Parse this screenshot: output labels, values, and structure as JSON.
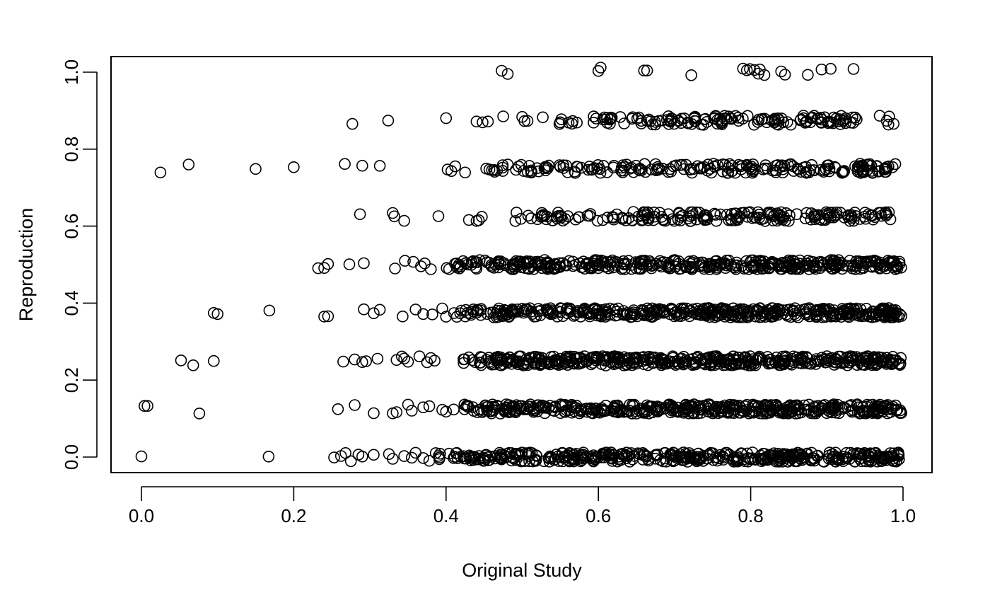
{
  "chart_data": {
    "type": "scatter",
    "title": "",
    "xlabel": "Original Study",
    "ylabel": "Reproduction",
    "xlim": [
      0.0,
      1.0
    ],
    "ylim": [
      0.0,
      1.0
    ],
    "xticks": [
      "0.0",
      "0.2",
      "0.4",
      "0.6",
      "0.8",
      "1.0"
    ],
    "yticks": [
      "0.0",
      "0.2",
      "0.4",
      "0.6",
      "0.8",
      "1.0"
    ],
    "grid": false,
    "legend": "none",
    "marker": "open-circle",
    "color": "#000000",
    "levels": [
      {
        "y": 1.0,
        "points": [
          0.473,
          0.481,
          0.6,
          0.603,
          0.66,
          0.664,
          0.722,
          0.79,
          0.795,
          0.799,
          0.805,
          0.81,
          0.812,
          0.818,
          0.84,
          0.845,
          0.875,
          0.893,
          0.905,
          0.935
        ],
        "dense": []
      },
      {
        "y": 0.875,
        "points": [
          0.277,
          0.324,
          0.4,
          0.44,
          0.448,
          0.455,
          0.475,
          0.5,
          0.503,
          0.507,
          0.527
        ],
        "dense": [
          {
            "from": 0.545,
            "to": 0.94,
            "count": 150
          },
          {
            "from": 0.962,
            "to": 0.998,
            "count": 5
          }
        ]
      },
      {
        "y": 0.75,
        "points": [
          0.025,
          0.062,
          0.15,
          0.2,
          0.267,
          0.29,
          0.313,
          0.402,
          0.407,
          0.412,
          0.425
        ],
        "dense": [
          {
            "from": 0.45,
            "to": 0.995,
            "count": 210
          }
        ]
      },
      {
        "y": 0.625,
        "points": [
          0.287,
          0.33,
          0.332,
          0.345,
          0.39,
          0.43,
          0.44,
          0.443,
          0.447
        ],
        "dense": [
          {
            "from": 0.49,
            "to": 0.995,
            "count": 200
          }
        ]
      },
      {
        "y": 0.5,
        "points": [
          0.232,
          0.24,
          0.245,
          0.273,
          0.292,
          0.333,
          0.346,
          0.357,
          0.367,
          0.372,
          0.38
        ],
        "dense": [
          {
            "from": 0.398,
            "to": 0.998,
            "count": 420
          }
        ]
      },
      {
        "y": 0.375,
        "points": [
          0.095,
          0.1,
          0.168,
          0.24,
          0.245,
          0.292,
          0.305,
          0.313,
          0.343,
          0.36,
          0.37,
          0.382,
          0.395,
          0.4
        ],
        "dense": [
          {
            "from": 0.41,
            "to": 0.998,
            "count": 460
          }
        ]
      },
      {
        "y": 0.25,
        "points": [
          0.052,
          0.068,
          0.095,
          0.265,
          0.28,
          0.29,
          0.295,
          0.31,
          0.335,
          0.342,
          0.345,
          0.35,
          0.365,
          0.375,
          0.38,
          0.385
        ],
        "dense": [
          {
            "from": 0.42,
            "to": 0.998,
            "count": 470
          }
        ]
      },
      {
        "y": 0.125,
        "points": [
          0.004,
          0.008,
          0.076,
          0.258,
          0.28,
          0.305,
          0.33,
          0.335,
          0.35,
          0.355,
          0.37,
          0.378,
          0.395,
          0.4,
          0.41
        ],
        "dense": [
          {
            "from": 0.42,
            "to": 0.998,
            "count": 460
          }
        ]
      },
      {
        "y": 0.0,
        "points": [
          0.0,
          0.167,
          0.253,
          0.262,
          0.268,
          0.275,
          0.285,
          0.29,
          0.305,
          0.325,
          0.33,
          0.345,
          0.355,
          0.36,
          0.37,
          0.378
        ],
        "dense": [
          {
            "from": 0.385,
            "to": 0.995,
            "count": 440
          }
        ]
      }
    ],
    "jitter_y": 0.012
  }
}
